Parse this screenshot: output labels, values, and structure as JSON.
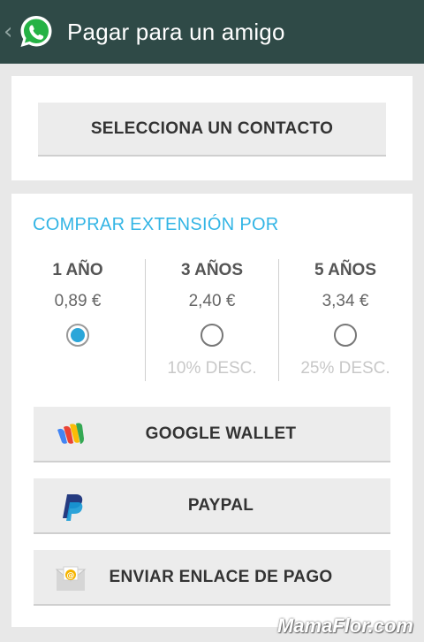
{
  "header": {
    "title": "Pagar para un amigo",
    "back_icon": "chevron-left-icon",
    "app_icon": "whatsapp-icon",
    "color": "#2f4a47"
  },
  "contact": {
    "select_label": "SELECCIONA UN CONTACTO"
  },
  "extension": {
    "title": "COMPRAR EXTENSIÓN POR",
    "accent": "#33b5e5",
    "plans": [
      {
        "name": "1 AÑO",
        "price": "0,89 €",
        "selected": true,
        "discount": ""
      },
      {
        "name": "3 AÑOS",
        "price": "2,40 €",
        "selected": false,
        "discount": "10% DESC."
      },
      {
        "name": "5 AÑOS",
        "price": "3,34 €",
        "selected": false,
        "discount": "25% DESC."
      }
    ]
  },
  "payment": {
    "google_wallet": {
      "label": "GOOGLE WALLET",
      "icon": "google-wallet-icon"
    },
    "paypal": {
      "label": "PAYPAL",
      "icon": "paypal-icon"
    },
    "send_link": {
      "label": "ENVIAR ENLACE DE PAGO",
      "icon": "email-envelope-icon"
    }
  },
  "watermark": "MamaFlor.com"
}
